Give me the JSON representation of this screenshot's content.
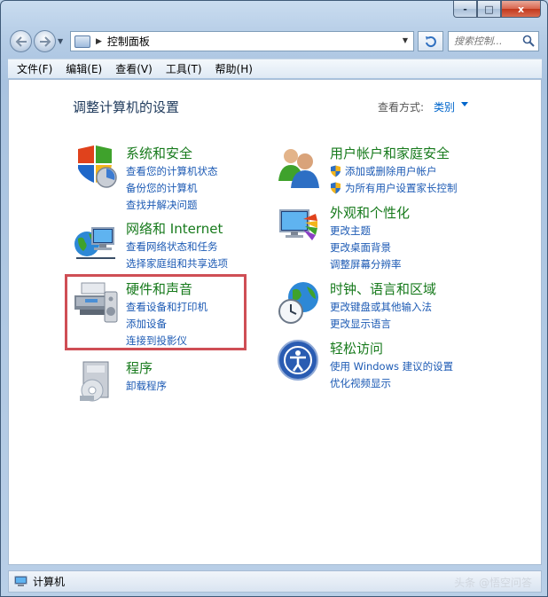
{
  "window": {
    "caption": {
      "minimize": "-",
      "maximize": "□",
      "close": "x"
    }
  },
  "address": {
    "path": "控制面板",
    "search_placeholder": "搜索控制..."
  },
  "menu": [
    "文件(F)",
    "编辑(E)",
    "查看(V)",
    "工具(T)",
    "帮助(H)"
  ],
  "main": {
    "title": "调整计算机的设置",
    "view_by_label": "查看方式:",
    "view_by_value": "类别"
  },
  "categories": [
    {
      "title": "系统和安全",
      "icon": "system-security-icon",
      "links": [
        {
          "text": "查看您的计算机状态"
        },
        {
          "text": "备份您的计算机"
        },
        {
          "text": "查找并解决问题"
        }
      ]
    },
    {
      "title": "网络和 Internet",
      "icon": "network-icon",
      "links": [
        {
          "text": "查看网络状态和任务"
        },
        {
          "text": "选择家庭组和共享选项"
        }
      ]
    },
    {
      "title": "硬件和声音",
      "icon": "hardware-sound-icon",
      "links": [
        {
          "text": "查看设备和打印机"
        },
        {
          "text": "添加设备"
        },
        {
          "text": "连接到投影仪"
        }
      ]
    },
    {
      "title": "程序",
      "icon": "programs-icon",
      "links": [
        {
          "text": "卸载程序"
        }
      ]
    },
    {
      "title": "用户帐户和家庭安全",
      "icon": "user-accounts-icon",
      "links": [
        {
          "text": "添加或删除用户帐户",
          "shield": true
        },
        {
          "text": "为所有用户设置家长控制",
          "shield": true
        }
      ]
    },
    {
      "title": "外观和个性化",
      "icon": "appearance-icon",
      "links": [
        {
          "text": "更改主题"
        },
        {
          "text": "更改桌面背景"
        },
        {
          "text": "调整屏幕分辨率"
        }
      ]
    },
    {
      "title": "时钟、语言和区域",
      "icon": "clock-language-icon",
      "links": [
        {
          "text": "更改键盘或其他输入法"
        },
        {
          "text": "更改显示语言"
        }
      ]
    },
    {
      "title": "轻松访问",
      "icon": "ease-of-access-icon",
      "links": [
        {
          "text": "使用 Windows 建议的设置"
        },
        {
          "text": "优化视频显示"
        }
      ]
    }
  ],
  "status": {
    "text": "计算机",
    "watermark": "头条 @悟空问答"
  }
}
